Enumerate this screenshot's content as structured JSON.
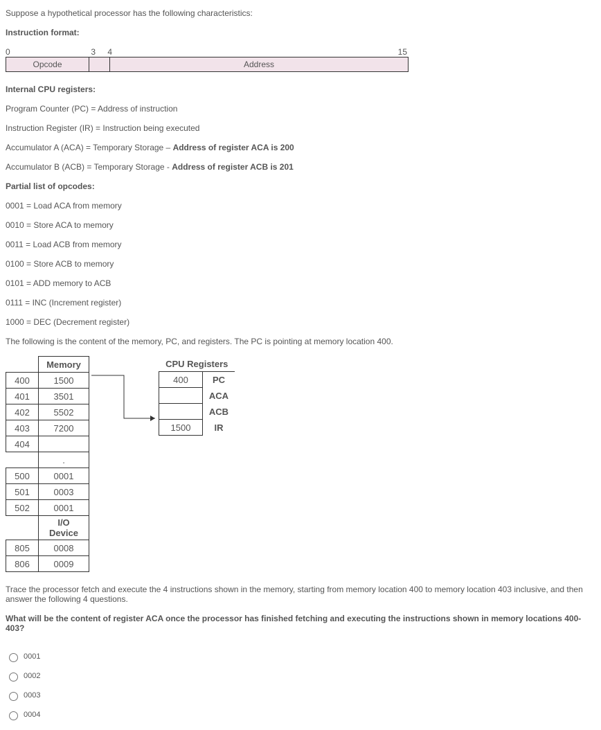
{
  "intro": "Suppose a hypothetical processor has the following characteristics:",
  "instruction_format_label": "Instruction format:",
  "bit_labels": {
    "b0": "0",
    "b3": "3",
    "b4": "4",
    "b15": "15"
  },
  "fields": {
    "opcode": "Opcode",
    "address": "Address"
  },
  "registers_header": "Internal CPU registers:",
  "registers": {
    "pc": "Program Counter (PC) = Address of instruction",
    "ir": "Instruction Register (IR) = Instruction being executed",
    "aca_pre": "Accumulator A (ACA) = Temporary Storage – ",
    "aca_bold": "Address of register ACA is 200",
    "acb_pre": "Accumulator B (ACB) = Temporary Storage - ",
    "acb_bold": "Address of register ACB is 201"
  },
  "opcodes_header": "Partial list of opcodes:",
  "opcodes": {
    "o1": "0001 = Load ACA from memory",
    "o2": "0010 = Store ACA to memory",
    "o3": "0011 = Load ACB from memory",
    "o4": "0100 = Store ACB to memory",
    "o5": "0101 = ADD memory to ACB",
    "o6": "0111 = INC (Increment register)",
    "o7": "1000 = DEC (Decrement register)"
  },
  "content_intro": "The following is the content of the memory, PC, and registers. The PC is pointing at memory location 400.",
  "memory_header": "Memory",
  "cpu_header": "CPU Registers",
  "io_header": "I/O Device",
  "memory": [
    {
      "addr": "400",
      "val": "1500"
    },
    {
      "addr": "401",
      "val": "3501"
    },
    {
      "addr": "402",
      "val": "5502"
    },
    {
      "addr": "403",
      "val": "7200"
    },
    {
      "addr": "404",
      "val": ""
    }
  ],
  "memory_dot": ".",
  "memory2": [
    {
      "addr": "500",
      "val": "0001"
    },
    {
      "addr": "501",
      "val": "0003"
    },
    {
      "addr": "502",
      "val": "0001"
    }
  ],
  "io": [
    {
      "addr": "805",
      "val": "0008"
    },
    {
      "addr": "806",
      "val": "0009"
    }
  ],
  "cpu": {
    "pc_val": "400",
    "pc_lbl": "PC",
    "aca_val": "",
    "aca_lbl": "ACA",
    "acb_val": "",
    "acb_lbl": "ACB",
    "ir_val": "1500",
    "ir_lbl": "IR"
  },
  "question_trace": "Trace the processor fetch and execute the 4 instructions shown in the memory, starting from memory location 400 to memory location 403 inclusive, and then answer the following 4 questions.",
  "question_main": "What will be the content of register ACA once the processor has finished fetching and executing the instructions shown in memory locations 400-403?",
  "options": {
    "a": "0001",
    "b": "0002",
    "c": "0003",
    "d": "0004"
  }
}
